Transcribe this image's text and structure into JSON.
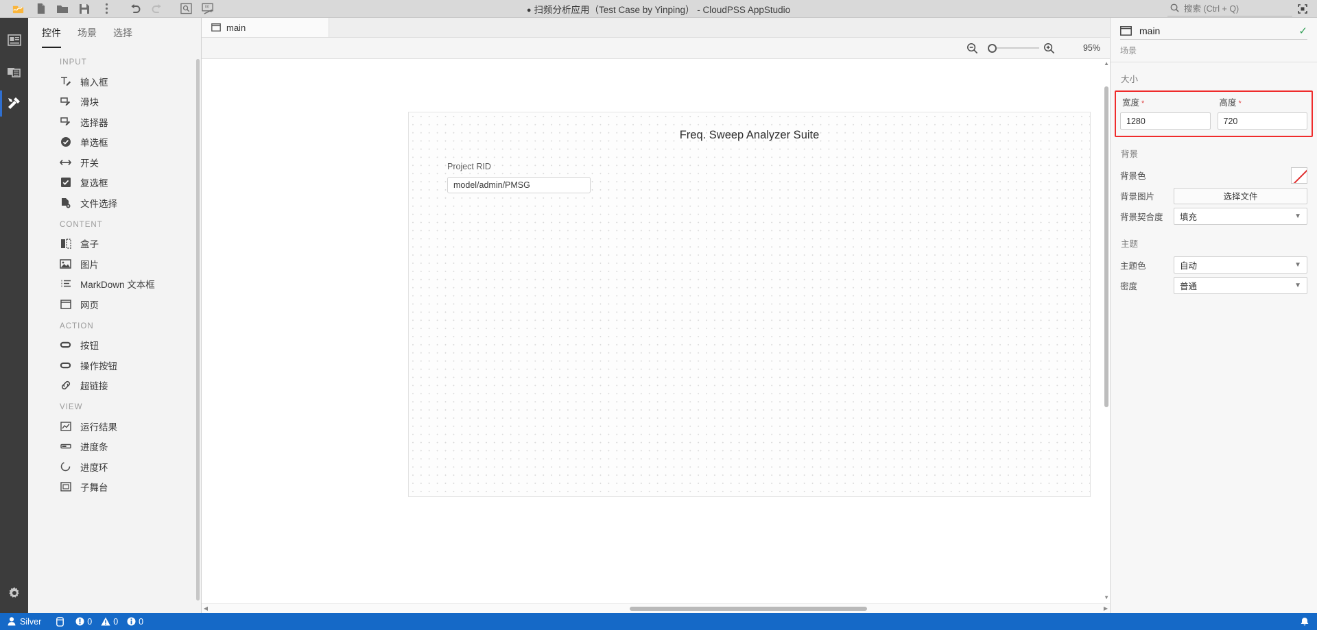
{
  "titlebar": {
    "title_prefix_dot": "●",
    "title": "扫频分析应用（Test Case by Yinping） - CloudPSS AppStudio",
    "tools": [
      {
        "name": "app-logo-icon",
        "label": "CloudPSS"
      },
      {
        "name": "new-file-icon",
        "label": "新建"
      },
      {
        "name": "open-folder-icon",
        "label": "打开"
      },
      {
        "name": "save-icon",
        "label": "保存"
      },
      {
        "name": "more-options-icon",
        "label": "更多"
      },
      {
        "name": "undo-icon",
        "label": "撤销"
      },
      {
        "name": "redo-icon",
        "label": "重做"
      },
      {
        "name": "preview-icon",
        "label": "预览"
      },
      {
        "name": "publish-icon",
        "label": "发布"
      }
    ],
    "search_placeholder": "搜索 (Ctrl + Q)",
    "window_button": "最大化"
  },
  "rail": {
    "items": [
      {
        "name": "rail-layout",
        "label": "控件"
      },
      {
        "name": "rail-scene",
        "label": "场景"
      },
      {
        "name": "rail-tools",
        "label": "工具"
      }
    ],
    "settings_label": "设置"
  },
  "palette": {
    "tabs": [
      {
        "label": "控件",
        "active": true
      },
      {
        "label": "场景",
        "active": false
      },
      {
        "label": "选择",
        "active": false
      }
    ],
    "groups": [
      {
        "title": "INPUT",
        "items": [
          {
            "icon": "text-input-icon",
            "label": "输入框"
          },
          {
            "icon": "slider-icon",
            "label": "滑块"
          },
          {
            "icon": "selector-icon",
            "label": "选择器"
          },
          {
            "icon": "radio-icon",
            "label": "单选框"
          },
          {
            "icon": "switch-icon",
            "label": "开关"
          },
          {
            "icon": "checkbox-icon",
            "label": "复选框"
          },
          {
            "icon": "file-picker-icon",
            "label": "文件选择"
          }
        ]
      },
      {
        "title": "CONTENT",
        "items": [
          {
            "icon": "box-icon",
            "label": "盒子"
          },
          {
            "icon": "image-icon",
            "label": "图片"
          },
          {
            "icon": "markdown-icon",
            "label": "MarkDown 文本框"
          },
          {
            "icon": "webpage-icon",
            "label": "网页"
          }
        ]
      },
      {
        "title": "ACTION",
        "items": [
          {
            "icon": "button-icon",
            "label": "按钮"
          },
          {
            "icon": "action-button-icon",
            "label": "操作按钮"
          },
          {
            "icon": "hyperlink-icon",
            "label": "超链接"
          }
        ]
      },
      {
        "title": "VIEW",
        "items": [
          {
            "icon": "result-icon",
            "label": "运行结果"
          },
          {
            "icon": "progress-bar-icon",
            "label": "进度条"
          },
          {
            "icon": "progress-ring-icon",
            "label": "进度环"
          },
          {
            "icon": "substage-icon",
            "label": "子舞台"
          }
        ]
      }
    ]
  },
  "editor": {
    "tab": {
      "label": "main",
      "icon": "stage-icon"
    },
    "zoom_percent": "95%",
    "zoom_out_icon": "zoom-out-icon",
    "zoom_in_icon": "zoom-in-icon"
  },
  "stage": {
    "title": "Freq. Sweep Analyzer Suite",
    "fields": [
      {
        "label": "Project RID",
        "value": "model/admin/PMSG"
      }
    ]
  },
  "inspector": {
    "name": "main",
    "type_label": "场景",
    "confirm_icon": "check-icon",
    "size": {
      "section_title": "大小",
      "width_label": "宽度",
      "width_required": "*",
      "width_value": "1280",
      "height_label": "高度",
      "height_required": "*",
      "height_value": "720",
      "highlight_color": "#ef2b2b"
    },
    "background": {
      "section_title": "背景",
      "color_label": "背景色",
      "color_value": "none",
      "image_label": "背景图片",
      "image_button": "选择文件",
      "fit_label": "背景契合度",
      "fit_value": "填充"
    },
    "theme": {
      "section_title": "主题",
      "color_label": "主题色",
      "color_value": "自动",
      "density_label": "密度",
      "density_value": "普通"
    }
  },
  "statusbar": {
    "user": "Silver",
    "db_icon": "database-icon",
    "errors": "0",
    "warnings": "0",
    "infos": "0",
    "bell_icon": "bell-icon",
    "accent": "#1569c7"
  }
}
